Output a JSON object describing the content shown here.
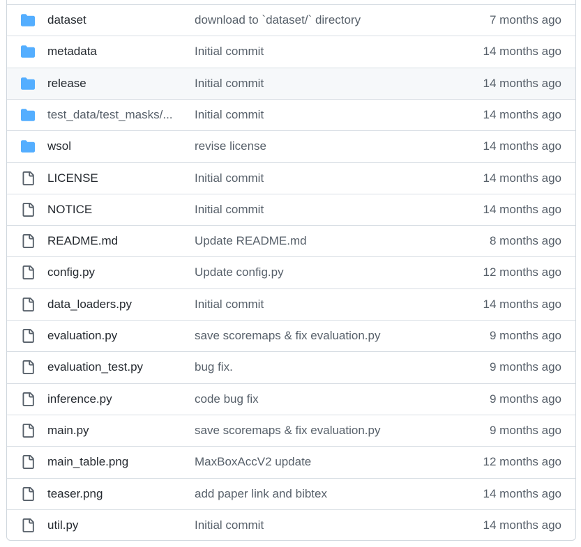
{
  "files": [
    {
      "type": "folder",
      "name": "dataset",
      "message": "download to `dataset/` directory",
      "age": "7 months ago"
    },
    {
      "type": "folder",
      "name": "metadata",
      "message": "Initial commit",
      "age": "14 months ago"
    },
    {
      "type": "folder",
      "name": "release",
      "message": "Initial commit",
      "age": "14 months ago"
    },
    {
      "type": "folder",
      "name": "test_data/test_masks/...",
      "message": "Initial commit",
      "age": "14 months ago"
    },
    {
      "type": "folder",
      "name": "wsol",
      "message": "revise license",
      "age": "14 months ago"
    },
    {
      "type": "file",
      "name": "LICENSE",
      "message": "Initial commit",
      "age": "14 months ago"
    },
    {
      "type": "file",
      "name": "NOTICE",
      "message": "Initial commit",
      "age": "14 months ago"
    },
    {
      "type": "file",
      "name": "README.md",
      "message": "Update README.md",
      "age": "8 months ago"
    },
    {
      "type": "file",
      "name": "config.py",
      "message": "Update config.py",
      "age": "12 months ago"
    },
    {
      "type": "file",
      "name": "data_loaders.py",
      "message": "Initial commit",
      "age": "14 months ago"
    },
    {
      "type": "file",
      "name": "evaluation.py",
      "message": "save scoremaps & fix evaluation.py",
      "age": "9 months ago"
    },
    {
      "type": "file",
      "name": "evaluation_test.py",
      "message": "bug fix.",
      "age": "9 months ago"
    },
    {
      "type": "file",
      "name": "inference.py",
      "message": "code bug fix",
      "age": "9 months ago"
    },
    {
      "type": "file",
      "name": "main.py",
      "message": "save scoremaps & fix evaluation.py",
      "age": "9 months ago"
    },
    {
      "type": "file",
      "name": "main_table.png",
      "message": "MaxBoxAccV2 update",
      "age": "12 months ago"
    },
    {
      "type": "file",
      "name": "teaser.png",
      "message": "add paper link and bibtex",
      "age": "14 months ago"
    },
    {
      "type": "file",
      "name": "util.py",
      "message": "Initial commit",
      "age": "14 months ago"
    }
  ],
  "colors": {
    "folder_icon": "#54aeff",
    "file_icon": "#57606a",
    "hover_row": "#f6f8fa"
  },
  "icons": {
    "folder": "folder-icon",
    "file": "file-icon"
  }
}
